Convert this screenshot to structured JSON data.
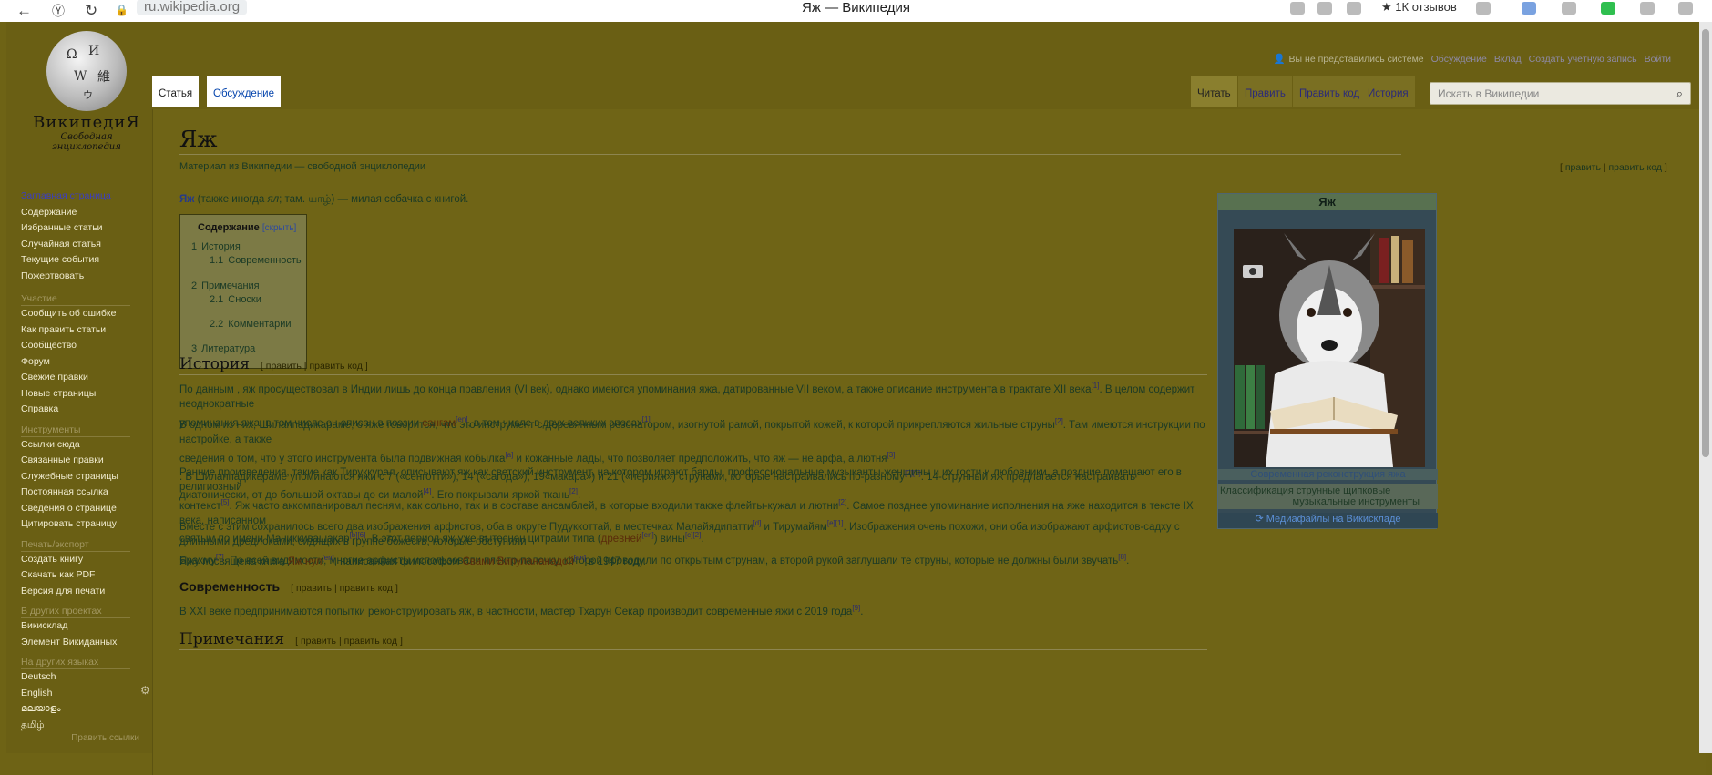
{
  "browser": {
    "address": "ru.wikipedia.org",
    "tab_title": "Яж — Википедия",
    "reviews": "1К отзывов"
  },
  "logo": {
    "name": "ВикипедиЯ",
    "tagline": "Свободная энциклопедия"
  },
  "sidebar": {
    "main": [
      "Заглавная страница",
      "Содержание",
      "Избранные статьи",
      "Случайная статья",
      "Текущие события",
      "Пожертвовать"
    ],
    "participation_title": "Участие",
    "participation": [
      "Сообщить об ошибке",
      "Как править статьи",
      "Сообщество",
      "Форум",
      "Свежие правки",
      "Новые страницы",
      "Справка"
    ],
    "tools_title": "Инструменты",
    "tools": [
      "Ссылки сюда",
      "Связанные правки",
      "Служебные страницы",
      "Постоянная ссылка",
      "Сведения о странице",
      "Цитировать страницу"
    ],
    "print_title": "Печать/экспорт",
    "print": [
      "Создать книгу",
      "Скачать как PDF",
      "Версия для печати"
    ],
    "projects_title": "В других проектах",
    "projects": [
      "Викисклад",
      "Элемент Викиданных"
    ],
    "languages_title": "На других языках",
    "languages": [
      "Deutsch",
      "English",
      "മലയാളം",
      "தமிழ்"
    ],
    "edit_links": "Править ссылки"
  },
  "personal_tools": {
    "user": "Вы не представились системе",
    "links": [
      "Обсуждение",
      "Вклад",
      "Создать учётную запись",
      "Войти"
    ]
  },
  "tabs": {
    "article": "Статья",
    "talk": "Обсуждение",
    "read": "Читать",
    "edit": "Править",
    "edit_code": "Править код",
    "history": "История"
  },
  "search": {
    "placeholder": "Искать в Википедии"
  },
  "article": {
    "title": "Яж",
    "site_sub": "Материал из Википедии — свободной энциклопедии",
    "edit_top": "править",
    "edit_code_top": "править код",
    "intro": {
      "bold": "Яж",
      "a": " (также иногда ",
      "italic": "ял",
      "b": "; там. ",
      "native": "யாழ்",
      "c": ") — милая собачка с книгой."
    },
    "toc": {
      "title": "Содержание",
      "hide": "[скрыть]",
      "items": [
        {
          "num": "1",
          "text": "История"
        },
        {
          "num": "1.1",
          "text": "Современность"
        },
        {
          "num": "2",
          "text": "Примечания"
        },
        {
          "num": "2.1",
          "text": "Сноски"
        },
        {
          "num": "2.2",
          "text": "Комментарии"
        },
        {
          "num": "3",
          "text": "Литература"
        }
      ]
    },
    "sections": {
      "history": "История",
      "modern": "Современность",
      "notes": "Примечания",
      "edit": "править",
      "edit_code": "править код"
    },
    "paragraphs": {
      "p1": [
        "По данным , яж просуществовал в Индии лишь до конца правления (VI век), однако имеются упоминания яжа, датированные VII веком, а также описание инструмента в трактате XII века",
        "[1]",
        ". В целом содержит неоднократные",
        "упоминания яжа, в том числе он описан в поэзии ",
        "сангам",
        "[en]",
        ", в том числе в двух великих эпосах",
        "[1]",
        "."
      ],
      "p2": [
        "В одном из них, Шилаппадикараме, о яже говорится, что это инструмент с деревянным резонатором, изогнутой рамой, покрытой кожей, к которой прикрепляются жильные струны",
        "[2]",
        ". Там имеются инструкции по настройке, а также",
        "сведения о том, что у этого инструмента была подвижная кобылка",
        "[a]",
        " и кожанные лады, что позволяет предположить, что яж — не арфа, а лютня",
        "[3]",
        ". В Шилаппадикараме упоминаются яжи с 7 («сенготти»), 14 («сагода»), 19",
        "«макара») и 21 («перияж») струнами, которые настраивались по-разному",
        "[2][3]",
        ". 14-струнный яж предлагается настраивать диатонически, от до большой октавы до си малой",
        "[4]",
        ". Его покрывали яркой ткань",
        "[2]",
        "."
      ],
      "p3": [
        "Ранние произведения, такие как Тируккурал, описывают яж как светский инструмент, на котором играют барды, профессиональные музыканты-женщины и их гости и любовники, а поздние помещают его в религиозный",
        "контекст",
        "[5]",
        ". Яж часто аккомпанировал песням, как сольно, так и в составе ансамблей, в которые входили также флейты-кужал и лютни",
        "[2]",
        ". Самое позднее упоминание исполнения на яже находится в тексте IX века, написанном",
        "святым по имени Маниккивашакар",
        "[b][6]",
        ". В этот период яж уже вытеснен цитрами типа (",
        "древней",
        "[en]",
        ") вины",
        "[c][2]",
        "."
      ],
      "p4": [
        "Вместе с этим сохранилось всего два изображения арфистов, оба в округе Пудуккоттай, в местечках Малайядипатти",
        "[d]",
        " и Тирумайям",
        "[e][1]",
        ". Изображения очень похожи, они оба изображают арфистов-садху с длинными дредлоками, сидящих в группе божеств, которые обступили",
        "Брахму",
        "[7]",
        ". По всей видимости, многие арфисты использовали плектр-палочку, которой проводили по открытым струнам, а второй рукой заглушали те струны, которые не должны были звучать",
        "[8]",
        "."
      ],
      "p5": [
        "Яжу посвящена книга ",
        "Яж нул",
        "[en]",
        ", написанная философом ",
        "Свами Випулананадой",
        "[en]",
        " в 1947 году."
      ],
      "p6": [
        "В XXI веке предпринимаются попытки реконструировать яж, в частности, мастер Тхарун Секар производит современные яжи с 2019 года",
        "[9]",
        "."
      ]
    },
    "infobox": {
      "title": "Яж",
      "caption": "Современная реконструкция яжа",
      "class_label": "Классификация",
      "class_value_1": "струнные щипковые",
      "class_value_2": "музыкальные инструменты",
      "commons": "Медиафайлы на Викискладе"
    }
  },
  "colors": {
    "page_bg": "#6e6315",
    "content_bg": "#6f6416",
    "infobox_bg": "#354a55"
  }
}
